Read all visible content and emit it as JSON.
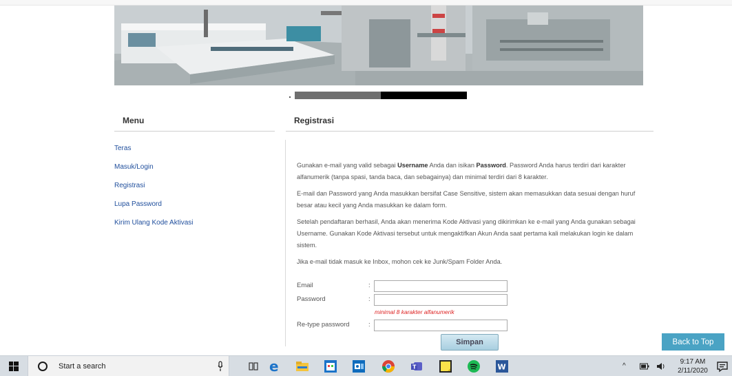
{
  "registration_progress": 0.5,
  "menu": {
    "title": "Menu",
    "items": [
      {
        "label": "Teras"
      },
      {
        "label": "Masuk/Login"
      },
      {
        "label": "Registrasi"
      },
      {
        "label": "Lupa Password"
      },
      {
        "label": "Kirim Ulang Kode Aktivasi"
      }
    ]
  },
  "main": {
    "title": "Registrasi",
    "p1": {
      "t1": "Gunakan e-mail yang valid sebagai ",
      "b1": "Username",
      "t2": " Anda dan isikan ",
      "b2": "Password",
      "t3": ". Password Anda harus terdiri dari karakter alfanumerik (tanpa spasi, tanda baca, dan sebagainya) dan minimal terdiri dari 8 karakter."
    },
    "p2": "E-mail dan Password yang Anda masukkan bersifat Case Sensitive, sistem akan memasukkan data sesuai dengan huruf besar atau kecil yang Anda masukkan ke dalam form.",
    "p3": "Setelah pendaftaran berhasil, Anda akan menerima Kode Aktivasi yang dikirimkan ke e-mail yang Anda gunakan sebagai Username. Gunakan Kode Aktivasi tersebut untuk mengaktifkan Akun Anda saat pertama kali melakukan login ke dalam sistem.",
    "p4": "Jika e-mail tidak masuk ke Inbox, mohon cek ke Junk/Spam Folder Anda."
  },
  "form": {
    "email_label": "Email",
    "password_label": "Password",
    "retype_label": "Re-type password",
    "colon": ":",
    "email_value": "",
    "password_value": "",
    "retype_value": "",
    "password_hint": "minimal 8 karakter alfanumerik",
    "submit_label": "Simpan"
  },
  "back_to_top": "Back to Top",
  "taskbar": {
    "search_placeholder": "Start a search",
    "time": "9:17 AM",
    "date": "2/11/2020",
    "pinned": [
      "task-view-icon",
      "edge-icon",
      "file-explorer-icon",
      "store-icon",
      "outlook-icon",
      "chrome-icon",
      "teams-icon",
      "sticky-notes-icon",
      "spotify-icon",
      "word-icon"
    ]
  },
  "colors": {
    "link": "#1f4e9c",
    "hint": "#dd2222",
    "back_to_top_bg": "#4aa3c4",
    "simpan_bg": "#a8cfe0"
  }
}
